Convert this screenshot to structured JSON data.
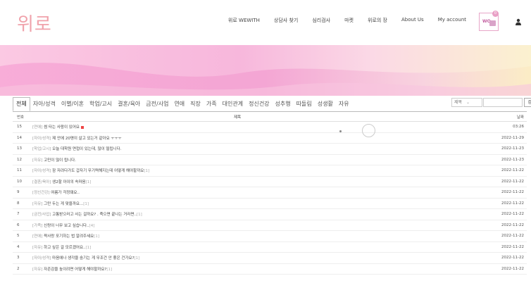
{
  "logo": "위로",
  "nav": [
    "위로 WEWITH",
    "상담사 찾기",
    "심리검사",
    "마켓",
    "위로의 장",
    "About Us",
    "My account"
  ],
  "cart": {
    "label": "WO",
    "badge": "0"
  },
  "categories": [
    "전체",
    "자아/성격",
    "이별/이혼",
    "학업/고시",
    "결혼/육아",
    "금전/사업",
    "연애",
    "직장",
    "가족",
    "대인관계",
    "정신건강",
    "성추행",
    "따돌림",
    "성생활",
    "자유"
  ],
  "search": {
    "select_value": "제목",
    "button": "검색"
  },
  "table": {
    "headers": {
      "num": "번호",
      "title": "제목",
      "date": "날짜"
    },
    "rows": [
      {
        "num": "15",
        "tag": "[연애]",
        "subject": "썸 타는 사람이 있어요",
        "count": "",
        "date": "03:26",
        "is_new": true
      },
      {
        "num": "14",
        "tag": "[자아/성격]",
        "subject": "제 안에 20명이 살고 있는거 같아요 ㅜㅜㅜ",
        "count": "",
        "date": "2022-11-29",
        "is_new": false
      },
      {
        "num": "13",
        "tag": "[학업/고시]",
        "subject": "오늘 대학원 면접이 있는데, 많이 떨립니다.",
        "count": "",
        "date": "2022-11-23",
        "is_new": false
      },
      {
        "num": "12",
        "tag": "[자유]",
        "subject": "고민이 많이 됩니다.",
        "count": "",
        "date": "2022-11-23",
        "is_new": false
      },
      {
        "num": "11",
        "tag": "[자아/성격]",
        "subject": "잠 자려다가도 갑자기 무기력해지는데 어떻게 해야할까요",
        "count": "[1]",
        "date": "2022-11-22",
        "is_new": false
      },
      {
        "num": "10",
        "tag": "[결혼/육아]",
        "subject": "생2할 아이의 속마음",
        "count": "[1]",
        "date": "2022-11-22",
        "is_new": false
      },
      {
        "num": "9",
        "tag": "[정신건강]",
        "subject": "여름가 걱정돼요..",
        "count": "",
        "date": "2022-11-22",
        "is_new": false
      },
      {
        "num": "8",
        "tag": "[자유]",
        "subject": "그만 두는 게 맞을까요...",
        "count": "[1]",
        "date": "2022-11-22",
        "is_new": false
      },
      {
        "num": "7",
        "tag": "[금전/사업]",
        "subject": "고통받으러고 사는 걸까요? . 죽으면 끝나는 거라면..",
        "count": "[1]",
        "date": "2022-11-22",
        "is_new": false
      },
      {
        "num": "6",
        "tag": "[가족]",
        "subject": "신랑이 너무 보고 싶습니다..",
        "count": "[4]",
        "date": "2022-11-22",
        "is_new": false
      },
      {
        "num": "5",
        "tag": "[연애]",
        "subject": "짝사랑 포기하는 법 알려주세요",
        "count": "[1]",
        "date": "2022-11-22",
        "is_new": false
      },
      {
        "num": "4",
        "tag": "[자유]",
        "subject": "하고 싶은 걸 모르겠어요..",
        "count": "[1]",
        "date": "2022-11-22",
        "is_new": false
      },
      {
        "num": "3",
        "tag": "[자아/성격]",
        "subject": "마음에나 생각을 숨기는 게 무조건 안 좋은 건가요?",
        "count": "[1]",
        "date": "2022-11-22",
        "is_new": false
      },
      {
        "num": "2",
        "tag": "[자유]",
        "subject": "자존감을 높이려면 어떻게 해야할까요?",
        "count": "[1]",
        "date": "2022-11-22",
        "is_new": false
      }
    ]
  },
  "colors": {
    "logo": "#f0a2ab",
    "banner_pink": "#f3a9d4",
    "banner_yellow": "#fbeec3",
    "new_badge": "#e44444"
  },
  "icons": [
    "cart-icon",
    "user-icon"
  ]
}
